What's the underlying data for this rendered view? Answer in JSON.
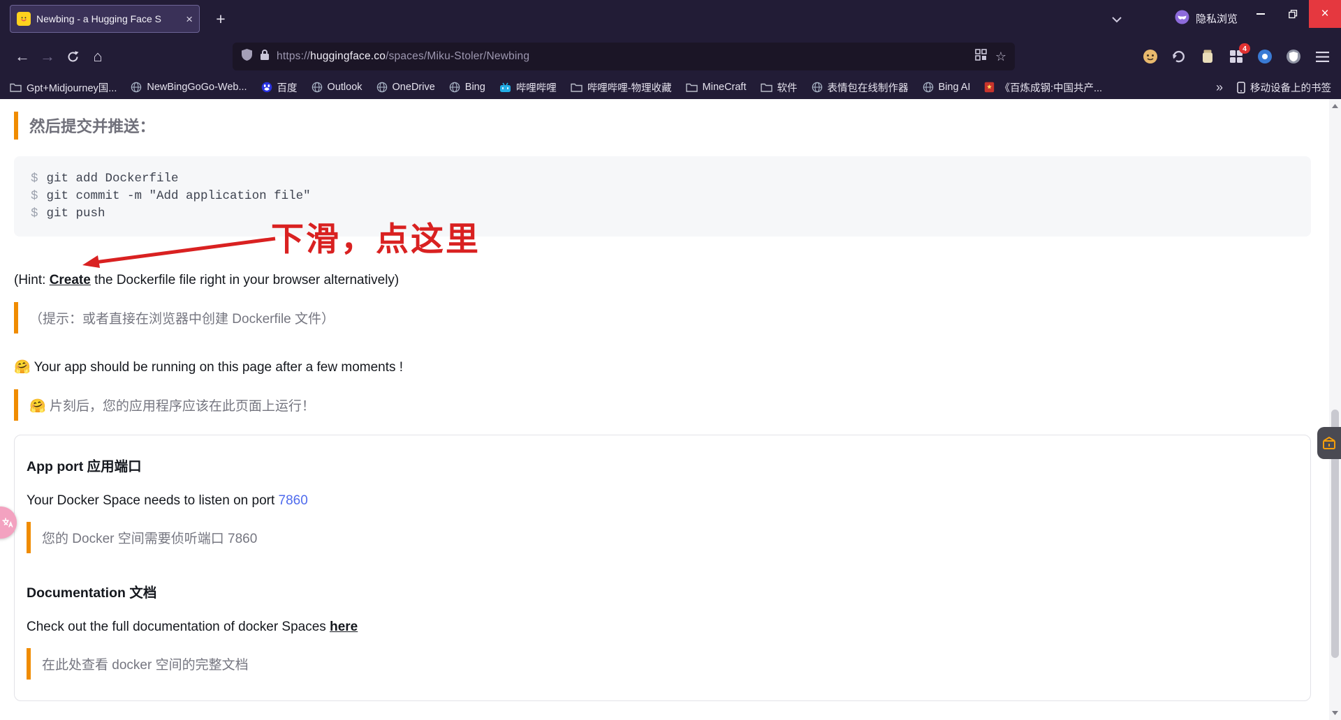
{
  "colors": {
    "chrome_bg": "#221c36",
    "accent_orange": "#f08c00",
    "annotation_red": "#d92121",
    "link_blue": "#4f6bed",
    "close_button_red": "#e5383f",
    "code_background": "#f6f7f9"
  },
  "browser": {
    "tab_title": "Newbing - a Hugging Face S",
    "private_label": "隐私浏览",
    "url": {
      "protocol": "https://",
      "domain": "huggingface.co",
      "path": "/spaces/Miku-Stoler/Newbing"
    },
    "extension_badge": "4",
    "bookmarks": [
      {
        "label": "Gpt+Midjourney国...",
        "icon": "folder-icon"
      },
      {
        "label": "NewBingGoGo-Web...",
        "icon": "globe-icon"
      },
      {
        "label": "百度",
        "icon": "baidu-icon"
      },
      {
        "label": "Outlook",
        "icon": "globe-icon"
      },
      {
        "label": "OneDrive",
        "icon": "globe-icon"
      },
      {
        "label": "Bing",
        "icon": "globe-icon"
      },
      {
        "label": "哔哩哔哩",
        "icon": "bilibili-icon"
      },
      {
        "label": "哔哩哔哩-物理收藏",
        "icon": "folder-icon"
      },
      {
        "label": "MineCraft",
        "icon": "folder-icon"
      },
      {
        "label": "软件",
        "icon": "folder-icon"
      },
      {
        "label": "表情包在线制作器",
        "icon": "globe-icon"
      },
      {
        "label": "Bing AI",
        "icon": "globe-icon"
      },
      {
        "label": "《百炼成钢:中国共产...",
        "icon": "red-book-icon"
      }
    ],
    "mobile_bookmarks_label": "移动设备上的书签"
  },
  "page": {
    "heading_push": "然后提交并推送：",
    "code": {
      "prompt": "$",
      "lines": [
        "git add Dockerfile",
        "git commit -m \"Add application file\"",
        "git push"
      ]
    },
    "annotation": "下滑，点这里",
    "hint": {
      "pre": "(Hint: ",
      "link": "Create",
      "post": " the Dockerfile file right in your browser alternatively)"
    },
    "hint_zh": "（提示：或者直接在浏览器中创建 Dockerfile 文件）",
    "running_en": "🤗 Your app should be running on this page after a few moments !",
    "running_zh": "🤗 片刻后，您的应用程序应该在此页面上运行！",
    "box": {
      "port_heading": "App port 应用端口",
      "port_text": "Your Docker Space needs to listen on port ",
      "port_link": "7860",
      "port_zh": "您的 Docker 空间需要侦听端口 7860",
      "doc_heading": "Documentation 文档",
      "doc_text": "Check out the full documentation of docker Spaces ",
      "doc_link": "here",
      "doc_zh": "在此处查看 docker 空间的完整文档"
    }
  }
}
